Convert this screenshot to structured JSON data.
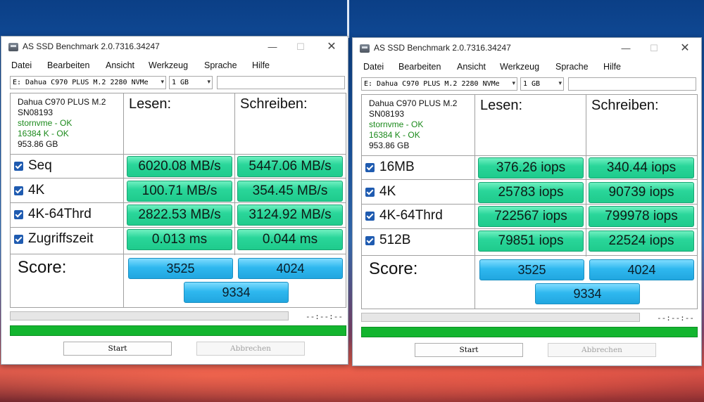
{
  "app": {
    "title": "AS SSD Benchmark 2.0.7316.34247",
    "menu": [
      "Datei",
      "Bearbeiten",
      "Ansicht",
      "Werkzeug",
      "Sprache",
      "Hilfe"
    ],
    "close_glyph": "✕"
  },
  "windows": [
    {
      "drive_select": "E: Dahua C970 PLUS M.2 2280 NVMe",
      "size_select": "1 GB",
      "info": {
        "model": "Dahua C970 PLUS M.2",
        "serial": "SN08193",
        "driver": "stornvme - OK",
        "align": "16384 K - OK",
        "capacity": "953.86 GB"
      },
      "headers": {
        "read": "Lesen:",
        "write": "Schreiben:"
      },
      "rows": [
        {
          "label": "Seq",
          "read": "6020.08 MB/s",
          "write": "5447.06 MB/s"
        },
        {
          "label": "4K",
          "read": "100.71 MB/s",
          "write": "354.45 MB/s"
        },
        {
          "label": "4K-64Thrd",
          "read": "2822.53 MB/s",
          "write": "3124.92 MB/s"
        },
        {
          "label": "Zugriffszeit",
          "read": "0.013 ms",
          "write": "0.044 ms"
        }
      ],
      "score": {
        "label": "Score:",
        "read": "3525",
        "write": "4024",
        "total": "9334"
      },
      "timer": "--:--:--",
      "buttons": {
        "start": "Start",
        "abort": "Abbrechen"
      }
    },
    {
      "drive_select": "E: Dahua C970 PLUS M.2 2280 NVMe",
      "size_select": "1 GB",
      "info": {
        "model": "Dahua C970 PLUS M.2",
        "serial": "SN08193",
        "driver": "stornvme - OK",
        "align": "16384 K - OK",
        "capacity": "953.86 GB"
      },
      "headers": {
        "read": "Lesen:",
        "write": "Schreiben:"
      },
      "rows": [
        {
          "label": "16MB",
          "read": "376.26 iops",
          "write": "340.44 iops"
        },
        {
          "label": "4K",
          "read": "25783 iops",
          "write": "90739 iops"
        },
        {
          "label": "4K-64Thrd",
          "read": "722567 iops",
          "write": "799978 iops"
        },
        {
          "label": "512B",
          "read": "79851 iops",
          "write": "22524 iops"
        }
      ],
      "score": {
        "label": "Score:",
        "read": "3525",
        "write": "4024",
        "total": "9334"
      },
      "timer": "--:--:--",
      "buttons": {
        "start": "Start",
        "abort": "Abbrechen"
      }
    }
  ]
}
